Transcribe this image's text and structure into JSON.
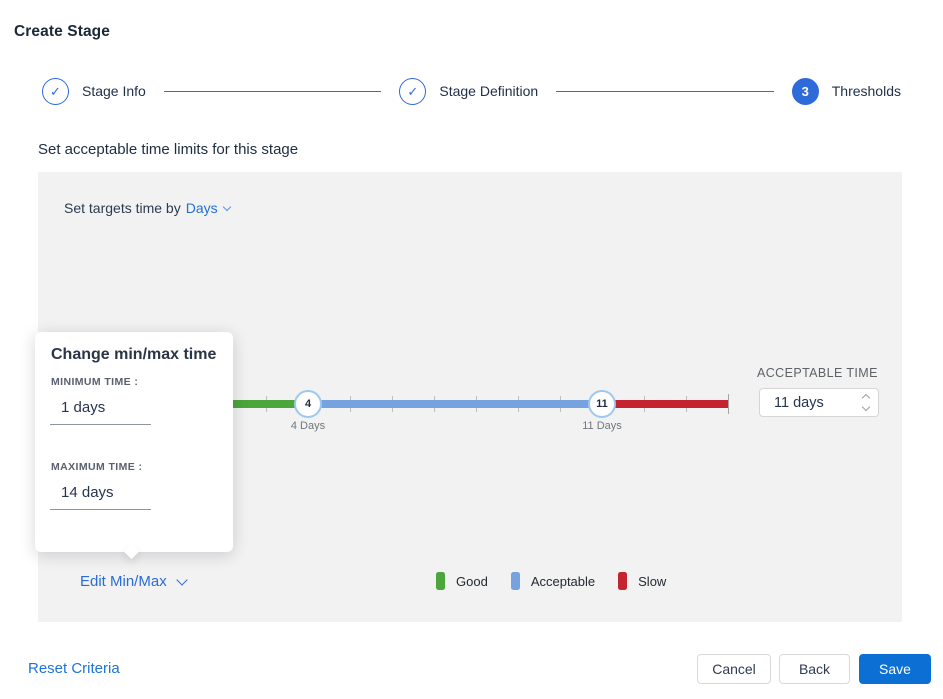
{
  "page": {
    "title": "Create Stage"
  },
  "icons": {
    "check": "✓"
  },
  "stepper": {
    "steps": [
      {
        "label": "Stage Info",
        "state": "complete"
      },
      {
        "label": "Stage Definition",
        "state": "complete"
      },
      {
        "label": "Thresholds",
        "state": "current",
        "number": 3
      }
    ]
  },
  "section_heading": "Set acceptable time limits for this stage",
  "panel": {
    "set_targets_prefix": "Set targets time by",
    "time_unit_selected": "Days",
    "acceptable_time_label": "ACCEPTABLE TIME",
    "acceptable_time_value": "11 days",
    "edit_minmax_label": "Edit Min/Max",
    "legend": [
      {
        "label": "Good",
        "color": "#4ca63c"
      },
      {
        "label": "Acceptable",
        "color": "#76a3df"
      },
      {
        "label": "Slow",
        "color": "#c42430"
      }
    ]
  },
  "slider": {
    "min_day": 1,
    "max_day": 14,
    "handles": [
      {
        "value": 4,
        "label": "4 Days"
      },
      {
        "value": 11,
        "label": "11 Days"
      }
    ],
    "segments": [
      {
        "name": "good",
        "color": "#4ca63c"
      },
      {
        "name": "acceptable",
        "color": "#76a3df"
      },
      {
        "name": "slow",
        "color": "#c42430"
      }
    ]
  },
  "popup": {
    "title": "Change min/max time",
    "minimum_label": "MINIMUM TIME :",
    "minimum_value": "1 days",
    "maximum_label": "MAXIMUM TIME :",
    "maximum_value": "14 days"
  },
  "footer": {
    "reset_label": "Reset Criteria",
    "cancel_label": "Cancel",
    "back_label": "Back",
    "save_label": "Save"
  },
  "colors": {
    "accent_blue": "#2e6ad8",
    "link_blue": "#1d73d8",
    "save_blue": "#0b6fd3",
    "panel_gray": "#f2f2f2",
    "handle_ring": "#9dc8ef"
  }
}
